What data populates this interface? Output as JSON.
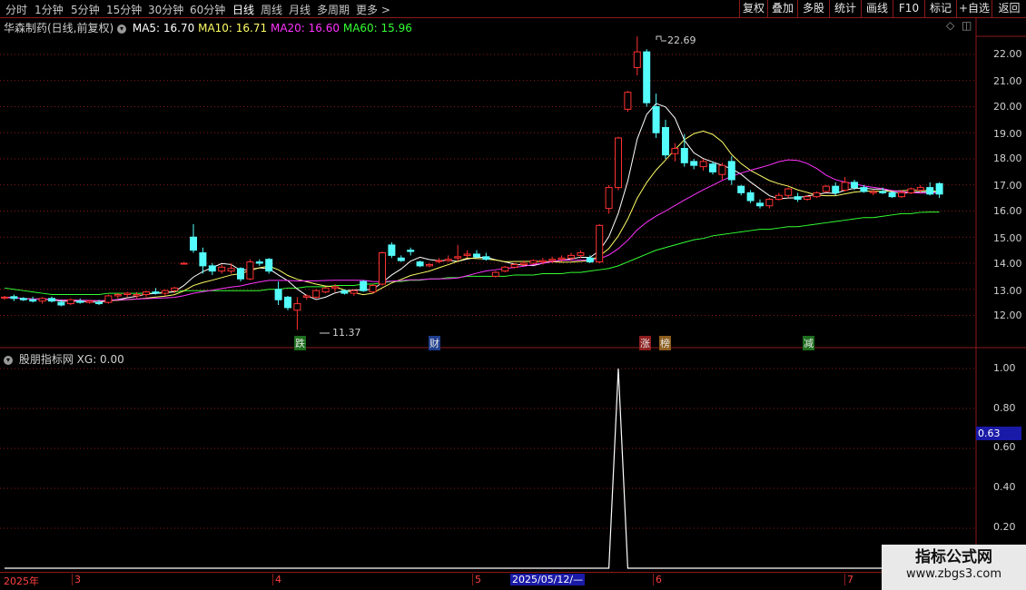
{
  "toolbar": {
    "tabs": [
      "分时",
      "1分钟",
      "5分钟",
      "15分钟",
      "30分钟",
      "60分钟",
      "日线",
      "周线",
      "月线",
      "多周期",
      "更多 >"
    ],
    "active_tab": "日线",
    "right_buttons": [
      "复权",
      "叠加",
      "多股",
      "统计",
      "画线",
      "F10",
      "标记",
      "+自选",
      "返回"
    ]
  },
  "stock_header": {
    "title": "华森制药(日线,前复权)",
    "ma5": "MA5: 16.70",
    "ma10": "MA10: 16.71",
    "ma20": "MA20: 16.60",
    "ma60": "MA60: 15.96"
  },
  "indicator_header": {
    "name": "股朋指标网",
    "xg": "XG: 0.00"
  },
  "price_axis": [
    "22.00",
    "21.00",
    "20.00",
    "19.00",
    "18.00",
    "17.00",
    "16.00",
    "15.00",
    "14.00",
    "13.00",
    "12.00"
  ],
  "indicator_axis": [
    "1.00",
    "0.80",
    "0.60",
    "0.40",
    "0.20"
  ],
  "indicator_marker": "0.63",
  "annotations": {
    "high": "22.69",
    "low": "11.37"
  },
  "event_markers": [
    "跌",
    "财",
    "涨",
    "榜",
    "减"
  ],
  "date_axis": [
    "2025年",
    "3",
    "4",
    "5",
    "2025/05/12/—",
    "6",
    "7"
  ],
  "watermark": {
    "line1": "指标公式网",
    "line2": "www.zbgs3.com"
  },
  "colors": {
    "up": "#ff3232",
    "down": "#54fcfc",
    "ma5": "#ffffff",
    "ma10": "#ffff66",
    "ma20": "#ff33ff",
    "ma60": "#33ff33",
    "grid": "#8b1a1a"
  },
  "chart_data": {
    "type": "candlestick",
    "candles": [
      [
        12.7,
        12.75,
        12.6,
        12.7
      ],
      [
        12.72,
        12.8,
        12.55,
        12.65
      ],
      [
        12.65,
        12.7,
        12.55,
        12.6
      ],
      [
        12.6,
        12.72,
        12.5,
        12.55
      ],
      [
        12.55,
        12.7,
        12.45,
        12.65
      ],
      [
        12.65,
        12.72,
        12.5,
        12.55
      ],
      [
        12.5,
        12.6,
        12.35,
        12.4
      ],
      [
        12.45,
        12.65,
        12.4,
        12.6
      ],
      [
        12.55,
        12.65,
        12.45,
        12.5
      ],
      [
        12.5,
        12.6,
        12.45,
        12.55
      ],
      [
        12.5,
        12.6,
        12.4,
        12.45
      ],
      [
        12.5,
        12.8,
        12.45,
        12.75
      ],
      [
        12.75,
        12.85,
        12.65,
        12.8
      ],
      [
        12.8,
        12.9,
        12.7,
        12.85
      ],
      [
        12.75,
        12.9,
        12.65,
        12.8
      ],
      [
        12.8,
        12.95,
        12.7,
        12.9
      ],
      [
        12.9,
        13.05,
        12.8,
        12.85
      ],
      [
        12.85,
        13.0,
        12.75,
        12.95
      ],
      [
        12.95,
        13.1,
        12.85,
        13.05
      ],
      [
        14.0,
        14.05,
        13.95,
        14.0
      ],
      [
        15.0,
        15.5,
        14.4,
        14.5
      ],
      [
        14.4,
        14.6,
        13.6,
        13.9
      ],
      [
        13.9,
        14.0,
        13.55,
        13.7
      ],
      [
        13.7,
        13.95,
        13.6,
        13.85
      ],
      [
        13.7,
        14.0,
        13.6,
        13.8
      ],
      [
        13.8,
        13.85,
        13.3,
        13.4
      ],
      [
        13.4,
        14.15,
        13.35,
        14.05
      ],
      [
        14.05,
        14.15,
        13.9,
        14.0
      ],
      [
        14.15,
        14.2,
        13.6,
        13.7
      ],
      [
        13.0,
        13.3,
        12.4,
        12.6
      ],
      [
        12.7,
        12.75,
        12.2,
        12.3
      ],
      [
        12.2,
        12.7,
        11.45,
        12.45
      ],
      [
        12.7,
        12.8,
        12.6,
        12.75
      ],
      [
        12.7,
        13.0,
        12.65,
        12.95
      ],
      [
        12.9,
        13.1,
        12.85,
        13.05
      ],
      [
        13.05,
        13.2,
        12.9,
        13.1
      ],
      [
        12.95,
        13.0,
        12.8,
        12.85
      ],
      [
        12.85,
        13.0,
        12.75,
        12.95
      ],
      [
        13.3,
        13.35,
        12.9,
        12.95
      ],
      [
        12.9,
        13.2,
        12.85,
        13.15
      ],
      [
        13.2,
        14.45,
        13.15,
        14.4
      ],
      [
        14.7,
        14.8,
        14.2,
        14.3
      ],
      [
        14.2,
        14.3,
        14.05,
        14.1
      ],
      [
        14.5,
        14.6,
        14.3,
        14.45
      ],
      [
        14.05,
        14.1,
        13.85,
        13.9
      ],
      [
        13.9,
        14.0,
        13.85,
        13.95
      ],
      [
        14.1,
        14.2,
        14.0,
        14.1
      ],
      [
        14.1,
        14.3,
        14.05,
        14.15
      ],
      [
        14.2,
        14.7,
        14.1,
        14.25
      ],
      [
        14.3,
        14.5,
        14.2,
        14.35
      ],
      [
        14.35,
        14.5,
        14.2,
        14.25
      ],
      [
        14.25,
        14.4,
        14.1,
        14.15
      ],
      [
        13.5,
        13.7,
        13.45,
        13.65
      ],
      [
        13.7,
        13.9,
        13.65,
        13.85
      ],
      [
        13.85,
        14.0,
        13.8,
        13.95
      ],
      [
        13.95,
        14.1,
        13.9,
        14.0
      ],
      [
        14.0,
        14.15,
        13.95,
        14.1
      ],
      [
        14.05,
        14.2,
        13.95,
        14.1
      ],
      [
        14.1,
        14.25,
        14.0,
        14.15
      ],
      [
        14.15,
        14.3,
        14.05,
        14.2
      ],
      [
        14.2,
        14.4,
        14.1,
        14.3
      ],
      [
        14.3,
        14.5,
        14.2,
        14.4
      ],
      [
        14.2,
        14.3,
        14.0,
        14.05
      ],
      [
        14.05,
        15.5,
        14.0,
        15.45
      ],
      [
        16.1,
        17.0,
        15.9,
        16.9
      ],
      [
        16.9,
        18.85,
        16.8,
        18.8
      ],
      [
        19.9,
        20.6,
        19.8,
        20.55
      ],
      [
        21.5,
        22.69,
        21.2,
        22.1
      ],
      [
        22.1,
        22.2,
        20.0,
        20.15
      ],
      [
        20.0,
        20.5,
        18.8,
        19.0
      ],
      [
        19.2,
        19.5,
        18.0,
        18.15
      ],
      [
        18.2,
        18.6,
        17.9,
        18.4
      ],
      [
        18.4,
        18.95,
        17.7,
        17.85
      ],
      [
        17.9,
        18.0,
        17.6,
        17.75
      ],
      [
        17.7,
        18.0,
        17.55,
        17.9
      ],
      [
        17.8,
        17.9,
        17.4,
        17.5
      ],
      [
        17.4,
        17.85,
        17.2,
        17.75
      ],
      [
        17.9,
        18.1,
        17.0,
        17.2
      ],
      [
        16.95,
        17.0,
        16.6,
        16.7
      ],
      [
        16.7,
        16.8,
        16.3,
        16.4
      ],
      [
        16.3,
        16.45,
        16.1,
        16.2
      ],
      [
        16.2,
        16.5,
        16.1,
        16.45
      ],
      [
        16.45,
        16.7,
        16.4,
        16.6
      ],
      [
        16.6,
        16.9,
        16.5,
        16.85
      ],
      [
        16.55,
        16.7,
        16.35,
        16.45
      ],
      [
        16.45,
        16.6,
        16.4,
        16.55
      ],
      [
        16.55,
        16.75,
        16.5,
        16.7
      ],
      [
        16.75,
        17.0,
        16.7,
        16.95
      ],
      [
        16.95,
        17.1,
        16.6,
        16.7
      ],
      [
        16.8,
        17.3,
        16.75,
        17.1
      ],
      [
        17.1,
        17.2,
        16.8,
        16.9
      ],
      [
        16.9,
        17.0,
        16.7,
        16.75
      ],
      [
        16.7,
        16.8,
        16.6,
        16.75
      ],
      [
        16.75,
        16.9,
        16.65,
        16.7
      ],
      [
        16.7,
        16.75,
        16.5,
        16.55
      ],
      [
        16.55,
        16.8,
        16.5,
        16.7
      ],
      [
        16.7,
        16.9,
        16.65,
        16.85
      ],
      [
        16.8,
        17.0,
        16.7,
        16.9
      ],
      [
        16.9,
        17.1,
        16.6,
        16.65
      ],
      [
        17.05,
        17.1,
        16.5,
        16.65
      ]
    ],
    "ma60": [
      13.05,
      13.0,
      12.95,
      12.9,
      12.85,
      12.8,
      12.8,
      12.8,
      12.8,
      12.8,
      12.8,
      12.85,
      12.85,
      12.85,
      12.85,
      12.85,
      12.85,
      12.9,
      12.9,
      12.95,
      12.95,
      12.95,
      12.95,
      12.95,
      12.95,
      12.95,
      12.95,
      12.95,
      13.0,
      13.0,
      13.05,
      13.05,
      13.1,
      13.1,
      13.1,
      13.15,
      13.15,
      13.15,
      13.2,
      13.2,
      13.25,
      13.3,
      13.3,
      13.35,
      13.35,
      13.4,
      13.4,
      13.45,
      13.45,
      13.5,
      13.5,
      13.5,
      13.5,
      13.5,
      13.55,
      13.55,
      13.55,
      13.6,
      13.6,
      13.6,
      13.65,
      13.65,
      13.7,
      13.75,
      13.8,
      13.9,
      14.05,
      14.2,
      14.35,
      14.5,
      14.6,
      14.7,
      14.8,
      14.9,
      14.95,
      15.05,
      15.1,
      15.15,
      15.2,
      15.25,
      15.3,
      15.3,
      15.35,
      15.4,
      15.4,
      15.45,
      15.5,
      15.55,
      15.6,
      15.65,
      15.7,
      15.75,
      15.75,
      15.8,
      15.85,
      15.9,
      15.9,
      15.95,
      15.96,
      15.96
    ],
    "indicator": {
      "type": "line",
      "series_name": "XG",
      "values": [
        0,
        0,
        0,
        0,
        0,
        0,
        0,
        0,
        0,
        0,
        0,
        0,
        0,
        0,
        0,
        0,
        0,
        0,
        0,
        0,
        0,
        0,
        0,
        0,
        0,
        0,
        0,
        0,
        0,
        0,
        0,
        0,
        0,
        0,
        0,
        0,
        0,
        0,
        0,
        0,
        0,
        0,
        0,
        0,
        0,
        0,
        0,
        0,
        0,
        0,
        0,
        0,
        0,
        0,
        0,
        0,
        0,
        0,
        0,
        0,
        0,
        0,
        0,
        0,
        0,
        1,
        0,
        0,
        0,
        0,
        0,
        0,
        0,
        0,
        0,
        0,
        0,
        0,
        0,
        0,
        0,
        0,
        0,
        0,
        0,
        0,
        0,
        0,
        0,
        0,
        0,
        0,
        0,
        0,
        0,
        0,
        0,
        0,
        0,
        0
      ]
    }
  }
}
